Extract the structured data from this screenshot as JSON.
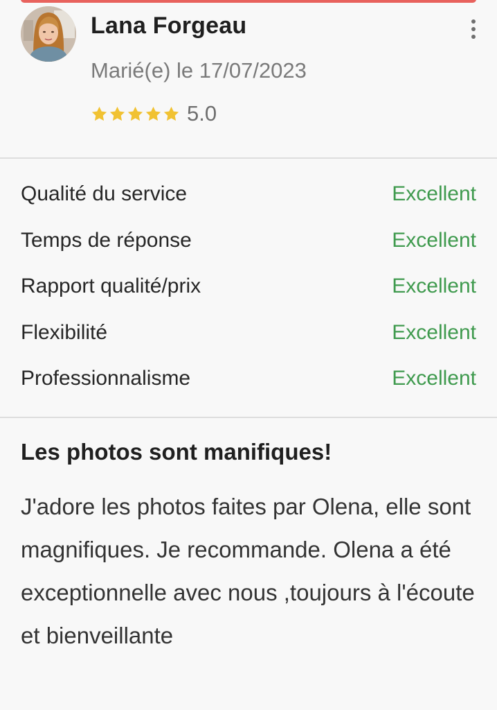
{
  "colors": {
    "accent": "#e8625d",
    "star": "#f1c232",
    "grade_text": "#3f9a4e",
    "secondary_text": "#7a7a7a",
    "divider": "#dddddd",
    "background": "#f8f8f8"
  },
  "review": {
    "reviewer_name": "Lana Forgeau",
    "married_date": "Marié(e) le 17/07/2023",
    "rating_value": "5.0",
    "stars": 5,
    "menu_icon": "more-vertical-icon",
    "ratings": [
      {
        "criterion": "Qualité du service",
        "grade": "Excellent"
      },
      {
        "criterion": "Temps de réponse",
        "grade": "Excellent"
      },
      {
        "criterion": "Rapport qualité/prix",
        "grade": "Excellent"
      },
      {
        "criterion": "Flexibilité",
        "grade": "Excellent"
      },
      {
        "criterion": "Professionnalisme",
        "grade": "Excellent"
      }
    ],
    "title": "Les photos sont manifiques!",
    "body": "J'adore les photos faites par Olena, elle sont magnifiques. Je recommande. Olena a été exceptionnelle avec nous ,toujours à l'écoute et bienveillante"
  }
}
